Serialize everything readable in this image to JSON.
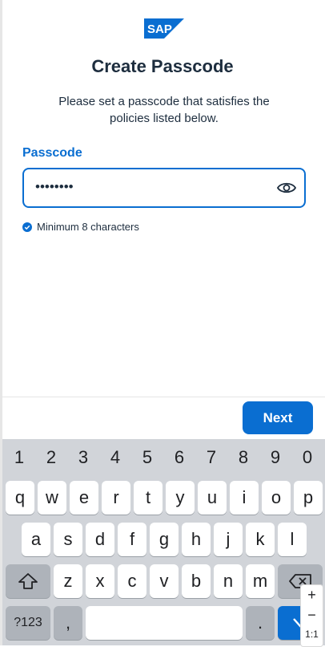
{
  "header": {
    "logo_text": "SAP",
    "title": "Create Passcode",
    "subtitle": "Please set a passcode that satisfies the policies listed below."
  },
  "form": {
    "passcode_label": "Passcode",
    "passcode_value": "••••••••",
    "toggle_visibility_icon": "eye-icon",
    "policies": [
      {
        "text": "Minimum 8 characters",
        "satisfied": true
      }
    ]
  },
  "actions": {
    "next_label": "Next"
  },
  "keyboard": {
    "number_row": [
      "1",
      "2",
      "3",
      "4",
      "5",
      "6",
      "7",
      "8",
      "9",
      "0"
    ],
    "row1": [
      "q",
      "w",
      "e",
      "r",
      "t",
      "y",
      "u",
      "i",
      "o",
      "p"
    ],
    "row2": [
      "a",
      "s",
      "d",
      "f",
      "g",
      "h",
      "j",
      "k",
      "l"
    ],
    "row3": [
      "z",
      "x",
      "c",
      "v",
      "b",
      "n",
      "m"
    ],
    "symbols_key": "?123",
    "comma_key": ",",
    "period_key": ".",
    "shift_icon": "shift-icon",
    "backspace_icon": "backspace-icon",
    "enter_icon": "check-icon"
  },
  "zoom_controls": {
    "plus": "+",
    "minus": "−",
    "ratio": "1:1"
  },
  "colors": {
    "accent": "#0a6ed1",
    "text": "#1d2d3e",
    "keyboard_bg": "#d1d4d9"
  }
}
